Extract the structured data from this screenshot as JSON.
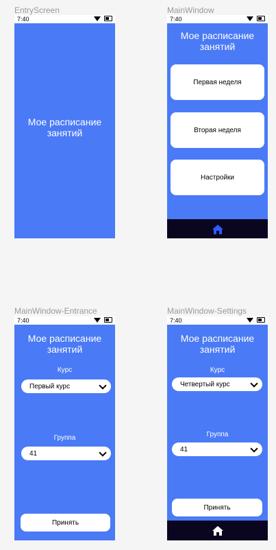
{
  "status": {
    "time": "7:40"
  },
  "frames": {
    "entry": {
      "label": "EntryScreen",
      "title": "Мое расписание занятий"
    },
    "main": {
      "label": "MainWindow",
      "title": "Мое расписание занятий",
      "buttons": [
        "Первая неделя",
        "Вторая неделя",
        "Настройки"
      ],
      "nav_icon": "home-icon"
    },
    "entrance": {
      "label": "MainWindow-Entrance",
      "title": "Мое расписание занятий",
      "course_label": "Курс",
      "course_value": "Первый курс",
      "group_label": "Группа",
      "group_value": "41",
      "accept": "Принять"
    },
    "settings": {
      "label": "MainWindow-Settings",
      "title": "Мое расписание занятий",
      "course_label": "Курс",
      "course_value": "Четвертый курс",
      "group_label": "Группа",
      "group_value": "41",
      "accept": "Принять",
      "nav_icon": "home-icon"
    }
  },
  "colors": {
    "accent": "#4a7af5",
    "navbar": "#0b0620",
    "home_icon_active": "#2b5cff",
    "home_icon_inactive": "#ffffff"
  }
}
